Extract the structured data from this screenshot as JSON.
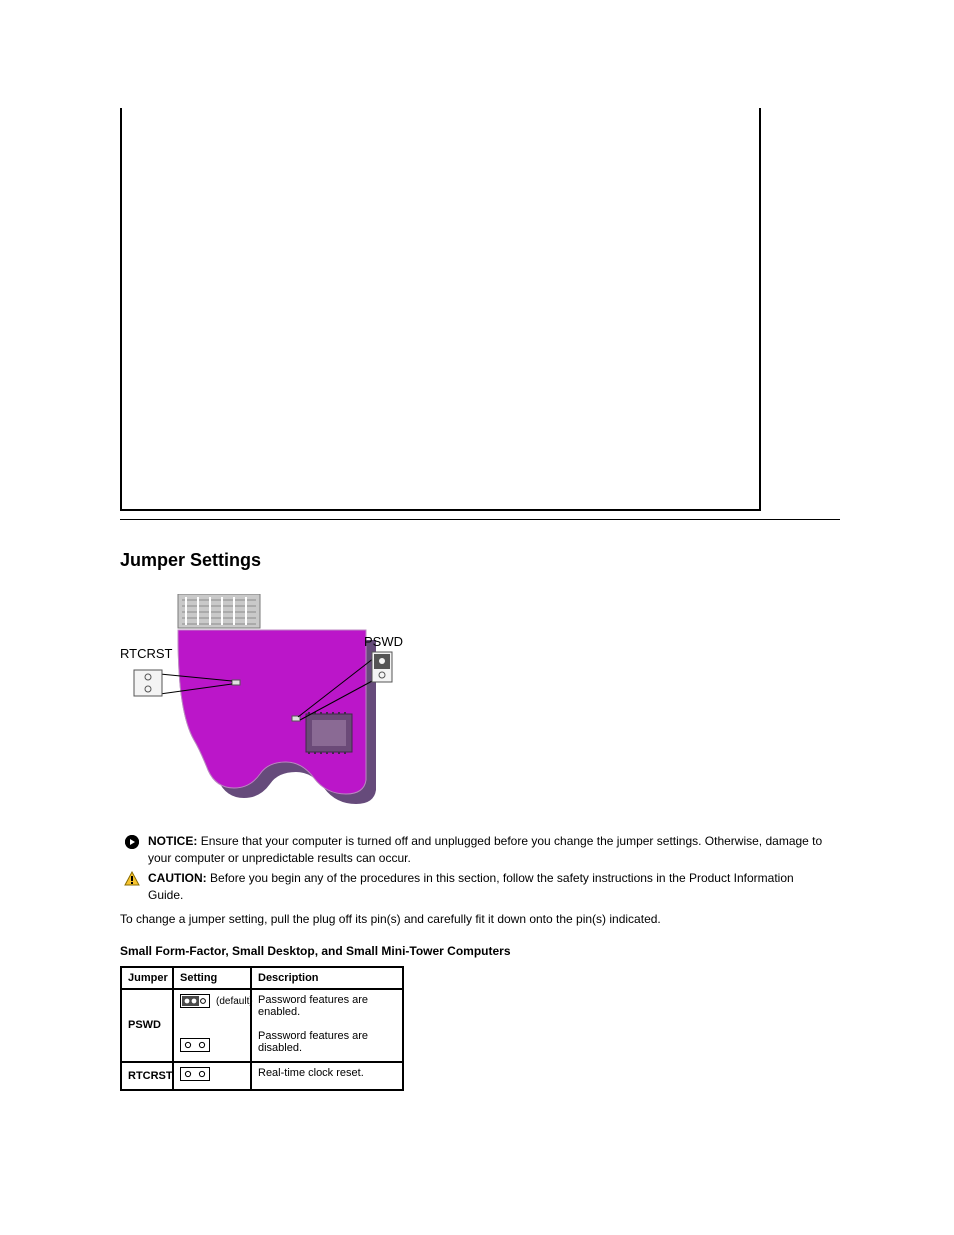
{
  "section_title": "Jumper Settings",
  "diagram": {
    "rtcrst_label": "RTCRST",
    "pswd_label": "PSWD"
  },
  "notice": {
    "lead": "NOTICE:",
    "body": "Ensure that your computer is turned off and unplugged before you change the jumper settings. Otherwise, damage to your computer or unpredictable results can occur."
  },
  "caution": {
    "lead": "CAUTION:",
    "body": "Before you begin any of the procedures in this section, follow the safety instructions in the Product Information Guide."
  },
  "para": "To change a jumper setting, pull the plug off its pin(s) and carefully fit it down onto the pin(s) indicated.",
  "table": {
    "caption": "Small Form-Factor, Small Desktop, and Small Mini-Tower Computers",
    "headers": [
      "Jumper",
      "Setting",
      "Description"
    ],
    "rows": [
      {
        "label": "PSWD",
        "settings": [
          {
            "type": "jumpered",
            "text": "(default)"
          },
          {
            "type": "open",
            "text": ""
          }
        ],
        "description": "Password features are enabled.\n\nPassword features are disabled."
      },
      {
        "label": "RTCRST",
        "settings": [
          {
            "type": "open",
            "text": ""
          }
        ],
        "description": "Real-time clock reset."
      }
    ]
  }
}
